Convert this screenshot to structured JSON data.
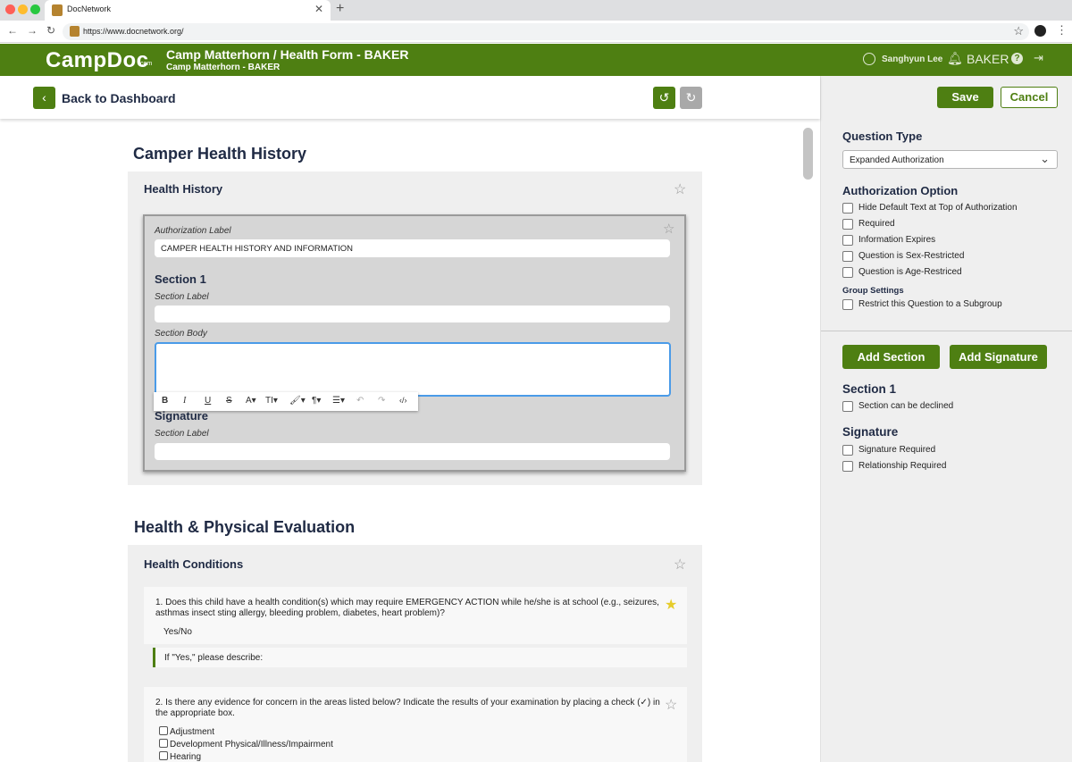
{
  "browser": {
    "tab_title": "DocNetwork",
    "new_tab_icon": "+",
    "url": "https://www.docnetwork.org/"
  },
  "header": {
    "logo": "CampDoc",
    "logo_suffix": ".com",
    "title": "Camp Matterhorn / Health Form - BAKER",
    "subtitle": "Camp Matterhorn - BAKER",
    "user_name": "Sanghyun Lee",
    "camp_code": "BAKER",
    "help_icon": "?"
  },
  "toolbar": {
    "back_label": "Back to Dashboard"
  },
  "health_history": {
    "heading": "Camper Health History",
    "card_title": "Health History",
    "authorization_label_caption": "Authorization Label",
    "authorization_label_value": "CAMPER HEALTH HISTORY AND INFORMATION",
    "section1_title": "Section 1",
    "section_label_caption": "Section Label",
    "section_body_caption": "Section Body",
    "signature_title": "Signature",
    "signature_label_caption": "Section Label"
  },
  "rte": {
    "bold": "B",
    "italic": "I",
    "underline": "U",
    "strike": "S",
    "font": "A",
    "size": "T",
    "pilcrow": "¶"
  },
  "physical_eval": {
    "heading": "Health & Physical Evaluation",
    "card_title": "Health Conditions",
    "q1_text": "1. Does this child have a health condition(s) which may require EMERGENCY ACTION while he/she is at school (e.g., seizures, asthmas insect sting allergy, bleeding problem, diabetes, heart problem)?",
    "q1_answer": "Yes/No",
    "q1_followup": "If \"Yes,\" please describe:",
    "q2_text": "2. Is there any evidence for concern in the areas listed below? Indicate the results of your examination by placing a check (✓) in the appropriate box.",
    "q2_options": [
      "Adjustment",
      "Development Physical/Illness/Impairment",
      "Hearing"
    ]
  },
  "sidebar": {
    "save_label": "Save",
    "cancel_label": "Cancel",
    "question_type_heading": "Question Type",
    "question_type_value": "Expanded Authorization",
    "auth_option_heading": "Authorization Option",
    "auth_options": [
      "Hide Default Text at Top of Authorization",
      "Required",
      "Information Expires",
      "Question is Sex-Restricted",
      "Question is Age-Restriced"
    ],
    "group_settings_heading": "Group Settings",
    "group_option": "Restrict this Question to a Subgroup",
    "add_section_label": "Add Section",
    "add_signature_label": "Add Signature",
    "section1_heading": "Section 1",
    "section1_option": "Section can be declined",
    "signature_heading": "Signature",
    "signature_options": [
      "Signature Required",
      "Relationship Required"
    ]
  }
}
